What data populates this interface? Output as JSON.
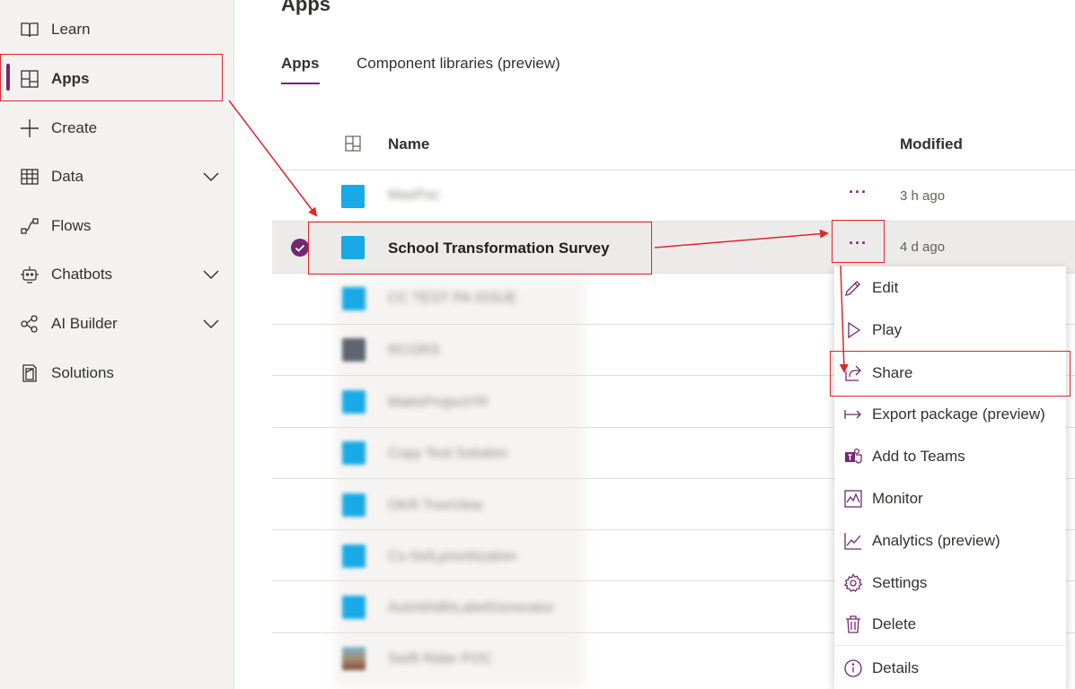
{
  "sidebar": {
    "items": [
      {
        "label": "Learn",
        "icon": "book-icon",
        "expandable": false
      },
      {
        "label": "Apps",
        "icon": "apps-icon",
        "expandable": false,
        "active": true
      },
      {
        "label": "Create",
        "icon": "plus-icon",
        "expandable": false
      },
      {
        "label": "Data",
        "icon": "table-icon",
        "expandable": true
      },
      {
        "label": "Flows",
        "icon": "flow-icon",
        "expandable": false
      },
      {
        "label": "Chatbots",
        "icon": "bot-icon",
        "expandable": true
      },
      {
        "label": "AI Builder",
        "icon": "ai-builder-icon",
        "expandable": true
      },
      {
        "label": "Solutions",
        "icon": "solutions-icon",
        "expandable": false
      }
    ]
  },
  "main": {
    "title": "Apps",
    "tabs": [
      {
        "label": "Apps",
        "active": true
      },
      {
        "label": "Component libraries (preview)",
        "active": false
      }
    ],
    "columns": {
      "name": "Name",
      "modified": "Modified"
    },
    "rows": [
      {
        "name": "MaxPoc",
        "modified": "3 h ago",
        "blurred": true,
        "more": "···"
      },
      {
        "name": "School Transformation Survey",
        "modified": "4 d ago",
        "blurred": false,
        "selected": true,
        "more": "···"
      },
      {
        "name": "CC TEST PA ISSUE",
        "blurred": true
      },
      {
        "name": "RCORS",
        "blurred": true
      },
      {
        "name": "MattsProjectYR",
        "blurred": true
      },
      {
        "name": "Copy Test Solution",
        "blurred": true
      },
      {
        "name": "OKR TreeView",
        "blurred": true
      },
      {
        "name": "Cx-SelLprioritization",
        "blurred": true
      },
      {
        "name": "AutoWidthLabelGenerator",
        "blurred": true
      },
      {
        "name": "Swift Rider POC",
        "blurred": true
      }
    ]
  },
  "context_menu": {
    "items": [
      {
        "label": "Edit",
        "icon": "pencil-icon"
      },
      {
        "label": "Play",
        "icon": "play-icon"
      },
      {
        "label": "Share",
        "icon": "share-icon",
        "highlighted": true
      },
      {
        "label": "Export package (preview)",
        "icon": "export-icon"
      },
      {
        "label": "Add to Teams",
        "icon": "teams-icon"
      },
      {
        "label": "Monitor",
        "icon": "monitor-icon"
      },
      {
        "label": "Analytics (preview)",
        "icon": "analytics-icon"
      },
      {
        "label": "Settings",
        "icon": "gear-icon"
      },
      {
        "label": "Delete",
        "icon": "trash-icon"
      },
      {
        "label": "Details",
        "icon": "info-icon"
      }
    ]
  },
  "colors": {
    "accent": "#742774",
    "annotation": "#e0252b",
    "app_icon": "#18a9e6",
    "sidebar_bg": "#f3f2f1"
  }
}
